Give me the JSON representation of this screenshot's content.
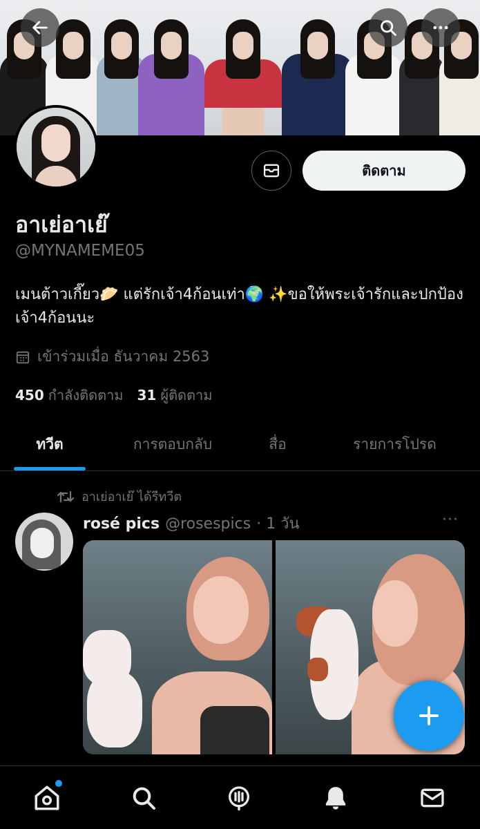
{
  "header": {
    "back_icon": "arrow-left-icon",
    "search_icon": "search-icon",
    "more_icon": "more-horizontal-icon"
  },
  "profile": {
    "display_name": "อาเย่อาเย๊",
    "handle": "@MYNAMEME05",
    "bio": "เมนต้าวเกี๊ยว🥟 แต่รักเจ้า4ก้อนเท่า🌍 ✨ขอให้พระเจ้ารักและปกป้องเจ้า4ก้อนนะ",
    "joined": "เข้าร่วมเมื่อ ธันวาคม 2563",
    "following_count": "450",
    "following_label": "กำลังติดตาม",
    "followers_count": "31",
    "followers_label": "ผู้ติดตาม",
    "follow_button": "ติดตาม"
  },
  "tabs": [
    {
      "label": "ทวีต",
      "active": true
    },
    {
      "label": "การตอบกลับ",
      "active": false
    },
    {
      "label": "สื่อ",
      "active": false
    },
    {
      "label": "รายการโปรด",
      "active": false
    }
  ],
  "tweet": {
    "retweet_label": "อาเย่อาเย๊ ได้รีทวีต",
    "author_name": "rosé pics",
    "author_handle": "@rosespics",
    "time": "· 1 วัน",
    "more": "···"
  },
  "bottom_nav": [
    "home-icon",
    "search-icon",
    "spaces-icon",
    "notifications-icon",
    "messages-icon"
  ],
  "colors": {
    "accent": "#1d9bf0",
    "background": "#000000",
    "text_primary": "#e7e9ea",
    "text_secondary": "#71767b"
  }
}
